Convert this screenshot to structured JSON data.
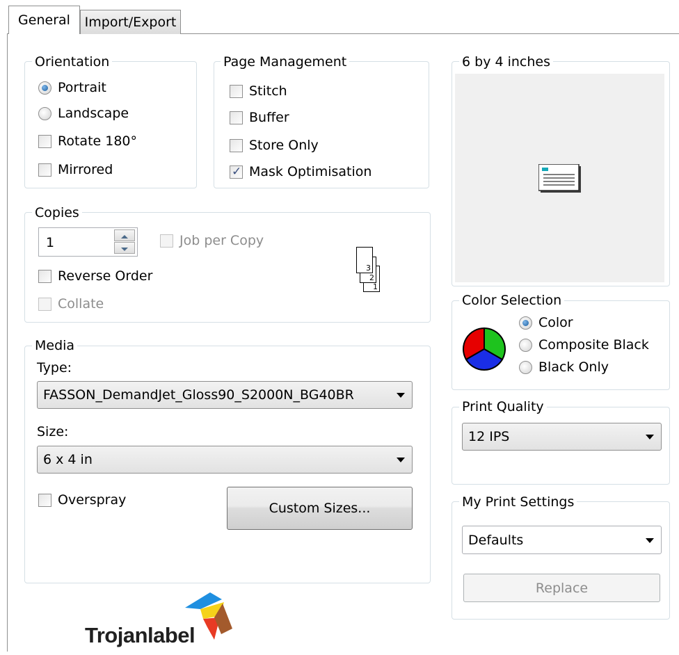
{
  "tabs": [
    {
      "label": "General"
    },
    {
      "label": "Import/Export"
    }
  ],
  "orientation": {
    "legend": "Orientation",
    "portrait": "Portrait",
    "landscape": "Landscape",
    "rotate": "Rotate 180°",
    "mirrored": "Mirrored"
  },
  "page_management": {
    "legend": "Page Management",
    "stitch": "Stitch",
    "buffer": "Buffer",
    "store_only": "Store Only",
    "mask_optimisation": "Mask Optimisation"
  },
  "preview": {
    "legend": "6 by 4 inches"
  },
  "copies": {
    "legend": "Copies",
    "value": "1",
    "job_per_copy": "Job per Copy",
    "reverse_order": "Reverse Order",
    "collate": "Collate",
    "stack_numbers": [
      "3",
      "2",
      "1"
    ]
  },
  "color_selection": {
    "legend": "Color Selection",
    "color": "Color",
    "composite_black": "Composite Black",
    "black_only": "Black Only",
    "wheel_colors": [
      "#e60000",
      "#1ec31e",
      "#1a2ee6"
    ]
  },
  "media": {
    "legend": "Media",
    "type_label": "Type:",
    "type_value": "FASSON_DemandJet_Gloss90_S2000N_BG40BR",
    "size_label": "Size:",
    "size_value": "6 x 4 in",
    "overspray": "Overspray",
    "custom_sizes": "Custom Sizes..."
  },
  "print_quality": {
    "legend": "Print Quality",
    "value": "12 IPS"
  },
  "my_print_settings": {
    "legend": "My Print Settings",
    "value": "Defaults",
    "replace": "Replace"
  },
  "logo": {
    "text": "Trojanlabel",
    "colors": [
      "#1f8fe0",
      "#f5d21a",
      "#e83a24",
      "#a35a2c"
    ]
  }
}
